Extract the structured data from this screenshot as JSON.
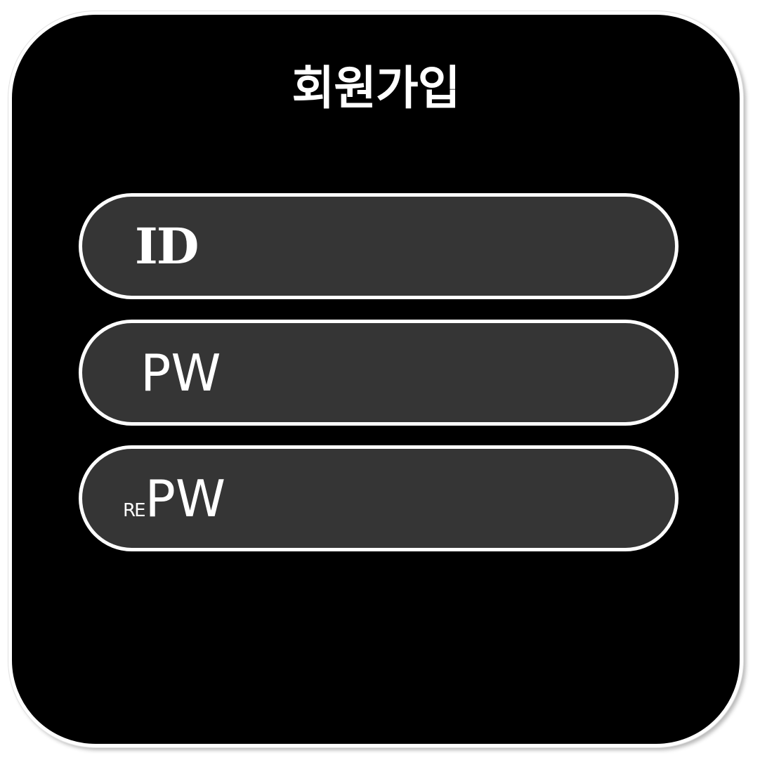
{
  "form": {
    "title": "회원가입",
    "fields": [
      {
        "label": "ID"
      },
      {
        "label": "PW"
      },
      {
        "prefix": "RE",
        "label": "PW"
      }
    ]
  },
  "colors": {
    "card_background": "#000000",
    "field_background": "#353535",
    "text": "#ffffff",
    "border": "#ffffff"
  }
}
